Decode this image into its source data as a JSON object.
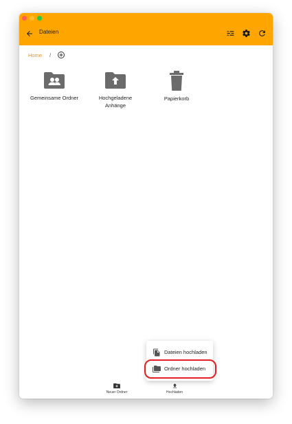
{
  "appbar": {
    "title": "Dateien",
    "back_icon": "arrow-back-icon",
    "actions": [
      "filter-list-icon",
      "gear-icon",
      "refresh-icon"
    ],
    "color": "#ffa500"
  },
  "breadcrumb": {
    "home": "Home",
    "separator": "/",
    "add_icon": "add-circle-icon",
    "accent": "#ff8c00"
  },
  "folders": [
    {
      "label": "Gemeinsame Ordner",
      "icon": "shared-folder-icon"
    },
    {
      "label": "Hochgeladene Anhänge",
      "icon": "upload-folder-icon"
    },
    {
      "label": "Papierkorb",
      "icon": "trash-icon"
    }
  ],
  "upload_menu": {
    "items": [
      {
        "label": "Dateien hochladen",
        "icon": "files-icon"
      },
      {
        "label": "Ordner hochladen",
        "icon": "folder-stack-icon"
      }
    ],
    "highlight_color": "#e21f1f"
  },
  "bottom_bar": {
    "new_folder": "Neuer Ordner",
    "upload": "Hochladen"
  }
}
